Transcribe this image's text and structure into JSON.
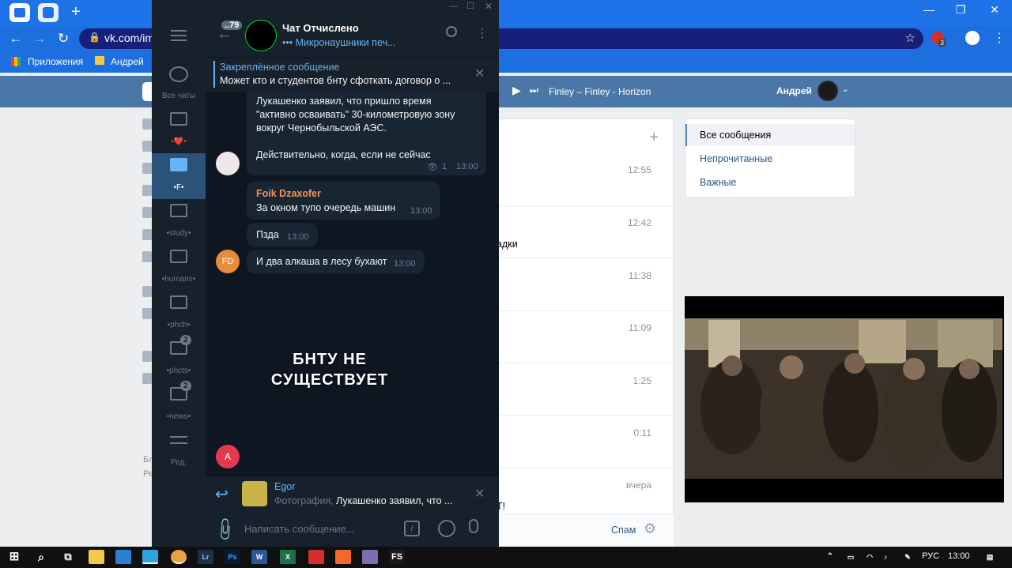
{
  "browser": {
    "url": "vk.com/im",
    "bookmarks": [
      "Приложения",
      "Андрей"
    ],
    "notif_count": "3"
  },
  "vk": {
    "player_track": "Finley – Finley - Horizon",
    "user_name": "Андрей",
    "menu": [
      "Все сообщения",
      "Непрочитанные",
      "Важные"
    ],
    "rows": [
      {
        "time": "12:55",
        "text": ""
      },
      {
        "time": "12:42",
        "text": "адки"
      },
      {
        "time": "11:38",
        "text": ""
      },
      {
        "time": "11:09",
        "text": ""
      },
      {
        "time": "1:25",
        "text": ""
      },
      {
        "time": "0:11",
        "text": ""
      },
      {
        "time": "вчера",
        "text": "T!"
      }
    ],
    "spam_label": "Спам",
    "left_text": [
      "Бл",
      "Ре"
    ]
  },
  "telegram": {
    "folders": [
      {
        "label": "Все чаты",
        "icon": "chats-icon",
        "badge": ""
      },
      {
        "label": "•❤️•",
        "icon": "folder-icon",
        "badge": ""
      },
      {
        "label": "•F•",
        "icon": "folder-icon",
        "badge": ""
      },
      {
        "label": "•study•",
        "icon": "folder-icon",
        "badge": ""
      },
      {
        "label": "•humans•",
        "icon": "folder-icon",
        "badge": ""
      },
      {
        "label": "•phch•",
        "icon": "folder-icon",
        "badge": ""
      },
      {
        "label": "•phcts•",
        "icon": "folder-icon",
        "badge": "2"
      },
      {
        "label": "•news•",
        "icon": "folder-icon",
        "badge": "2"
      },
      {
        "label": "Ред.",
        "icon": "settings-icon",
        "badge": ""
      }
    ],
    "back_badge": "..79",
    "chat_title": "Чат Отчислено",
    "chat_status": "••• Микронаушники печ...",
    "pinned_title": "Закреплённое сообщение",
    "pinned_text": "Может кто и студентов бнту сфоткать договор о ...",
    "messages": [
      {
        "text": "Лукашенко заявил, что пришло время \"активно осваивать\" 30-километровую зону вокруг Чернобыльской АЭС.",
        "text2": "Действительно, когда, если не сейчас",
        "views": "1",
        "time": "13:00"
      },
      {
        "author": "Foik Dzaxofer",
        "text": "За окном тупо очередь машин",
        "time": "13:00"
      },
      {
        "text": "Пзда",
        "time": "13:00"
      },
      {
        "text": "И два алкаша в лесу бухают",
        "time": "13:00",
        "avatar": "FD"
      }
    ],
    "sticker_text": "БНТУ НЕ СУЩЕСТВУЕТ",
    "bottom_avatar": "A",
    "reply_name": "Egor",
    "reply_prefix": "Фотография,",
    "reply_text": "Лукашенко заявил, что ...",
    "input_placeholder": "Написать сообщение..."
  },
  "taskbar": {
    "lang": "РУС",
    "time": "13:00",
    "apps": [
      "Lr",
      "Ps",
      "W",
      "X",
      "FS"
    ]
  }
}
